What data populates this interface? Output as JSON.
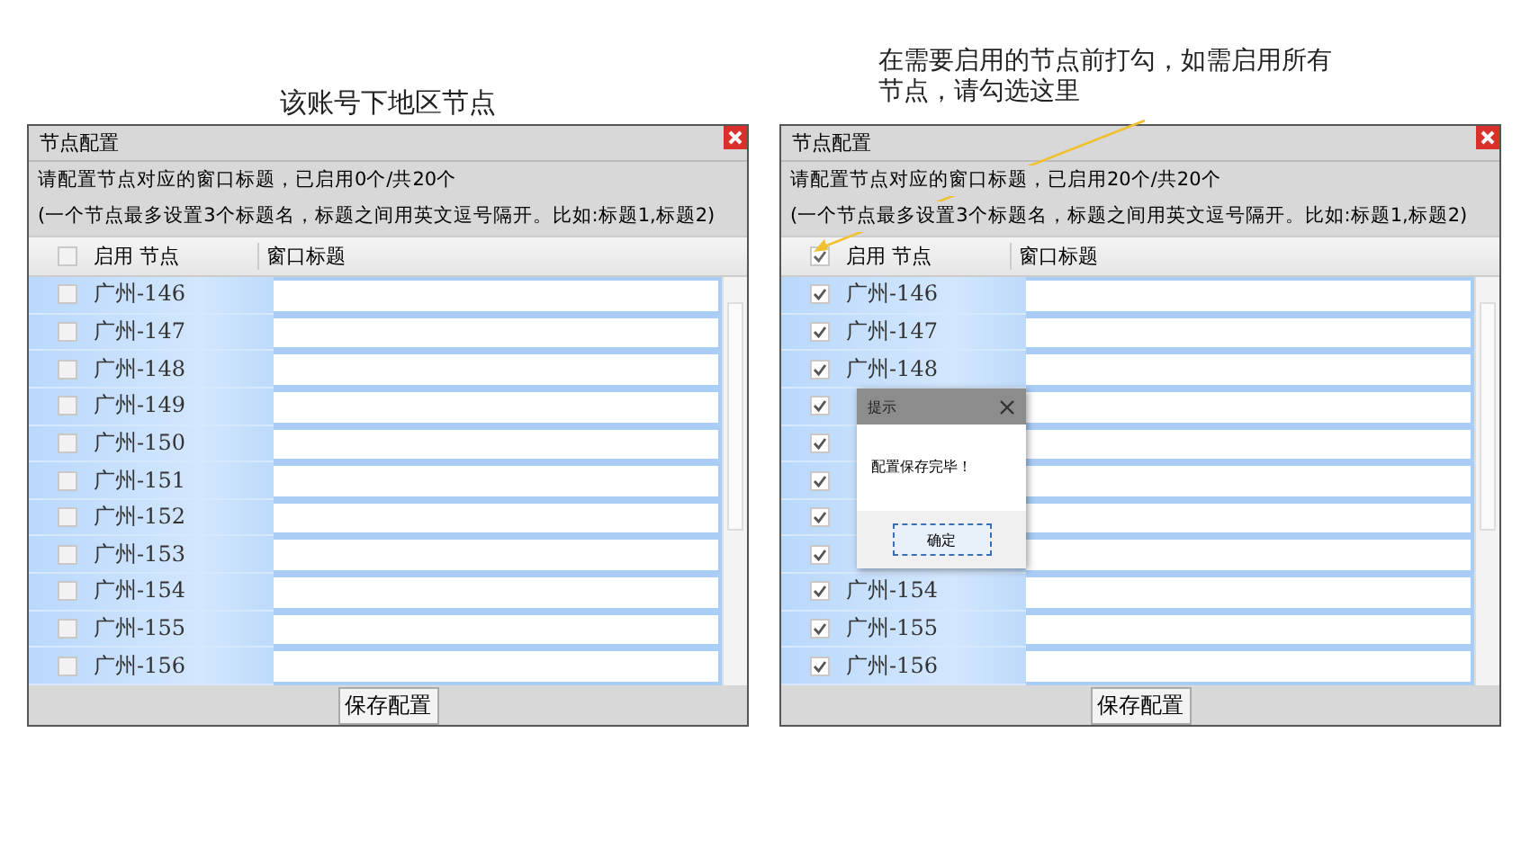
{
  "panels": [
    {
      "caption": "该账号下地区节点",
      "title": "节点配置",
      "info": "请配置节点对应的窗口标题，已启用0个/共20个",
      "hint": "(一个节点最多设置3个标题名，标题之间用英文逗号隔开。比如:标题1,标题2)",
      "columns": [
        "启用 节点",
        "窗口标题"
      ],
      "select_all_checked": false,
      "rows": [
        {
          "name": "广州-146",
          "checked": false
        },
        {
          "name": "广州-147",
          "checked": false
        },
        {
          "name": "广州-148",
          "checked": false
        },
        {
          "name": "广州-149",
          "checked": false
        },
        {
          "name": "广州-150",
          "checked": false
        },
        {
          "name": "广州-151",
          "checked": false
        },
        {
          "name": "广州-152",
          "checked": false
        },
        {
          "name": "广州-153",
          "checked": false
        },
        {
          "name": "广州-154",
          "checked": false
        },
        {
          "name": "广州-155",
          "checked": false
        },
        {
          "name": "广州-156",
          "checked": false
        }
      ],
      "save_button": "保存配置"
    },
    {
      "caption": "在需要启用的节点前打勾，如需启用所有节点，请勾选这里",
      "title": "节点配置",
      "info": "请配置节点对应的窗口标题，已启用20个/共20个",
      "hint": "(一个节点最多设置3个标题名，标题之间用英文逗号隔开。比如:标题1,标题2)",
      "columns": [
        "启用 节点",
        "窗口标题"
      ],
      "select_all_checked": true,
      "rows": [
        {
          "name": "广州-146",
          "checked": true
        },
        {
          "name": "广州-147",
          "checked": true
        },
        {
          "name": "广州-148",
          "checked": true
        },
        {
          "checked": true
        },
        {
          "checked": true
        },
        {
          "checked": true
        },
        {
          "checked": true
        },
        {
          "checked": true
        },
        {
          "name": "广州-154",
          "checked": true
        },
        {
          "name": "广州-155",
          "checked": true
        },
        {
          "name": "广州-156",
          "checked": true
        }
      ],
      "save_button": "保存配置",
      "dialog": {
        "title": "提示",
        "message": "配置保存完毕！",
        "ok_button": "确定"
      }
    }
  ]
}
